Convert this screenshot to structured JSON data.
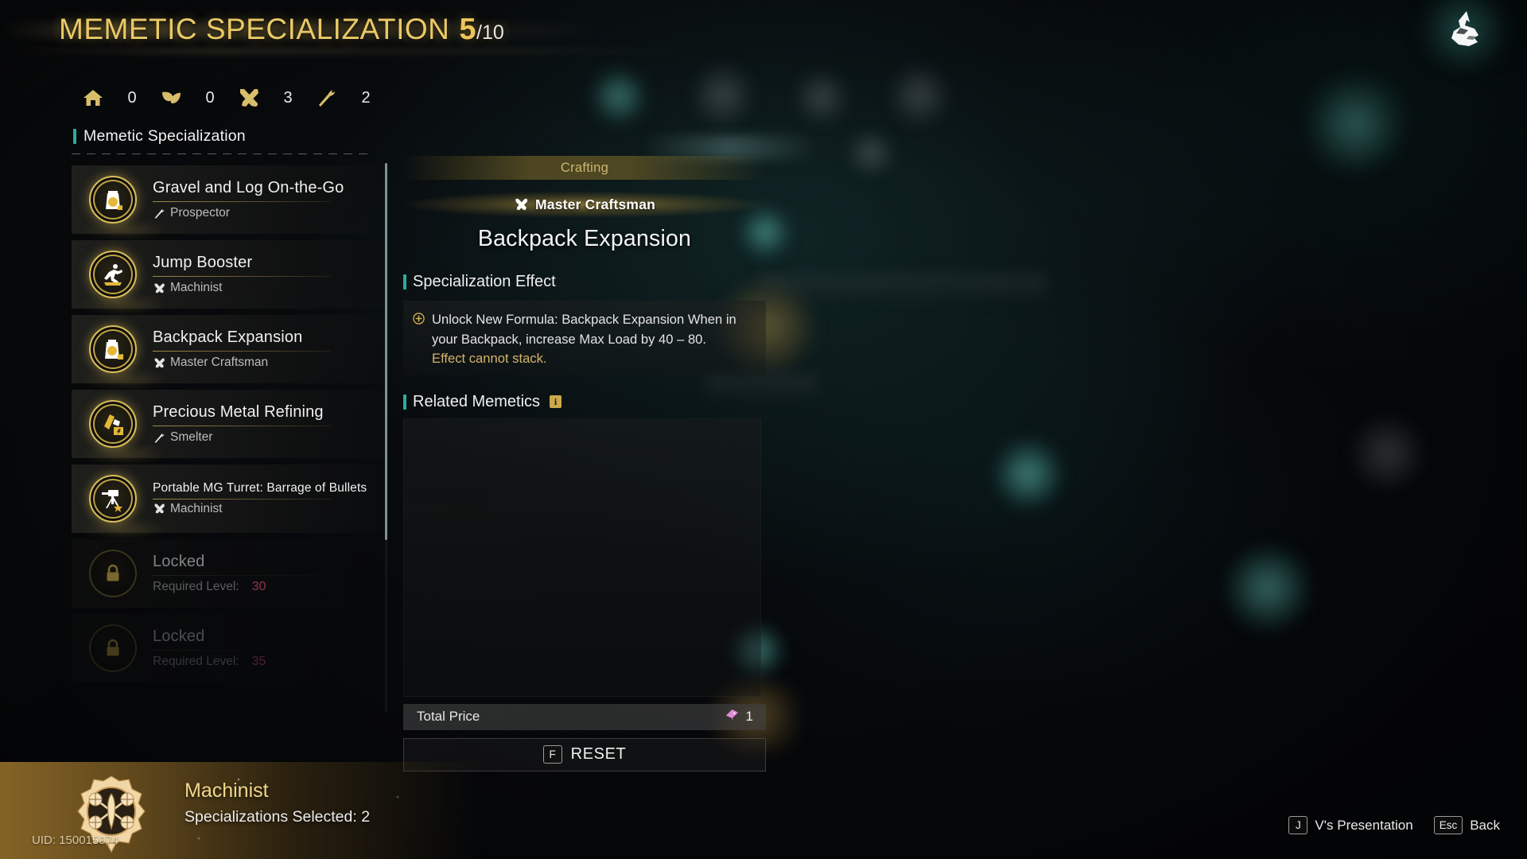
{
  "header": {
    "title": "MEMETIC SPECIALIZATION",
    "current": "5",
    "total": "/10"
  },
  "stats": [
    {
      "icon": "house-icon",
      "value": "0"
    },
    {
      "icon": "leaf-icon",
      "value": "0"
    },
    {
      "icon": "crossed-tools-icon",
      "value": "3"
    },
    {
      "icon": "axe-icon",
      "value": "2"
    }
  ],
  "sidebar": {
    "section_title": "Memetic Specialization",
    "items": [
      {
        "name": "Gravel and Log On-the-Go",
        "class": "Prospector",
        "class_icon": "axe-icon",
        "icon": "bag-gold-icon",
        "state": "unlocked",
        "wrap": false
      },
      {
        "name": "Jump Booster",
        "class": "Machinist",
        "class_icon": "crossed-tools-icon",
        "icon": "jump-runner-icon",
        "state": "unlocked",
        "wrap": false
      },
      {
        "name": "Backpack Expansion",
        "class": "Master Craftsman",
        "class_icon": "crossed-tools-icon",
        "icon": "backpack-icon",
        "state": "unlocked",
        "wrap": false
      },
      {
        "name": "Precious Metal Refining",
        "class": "Smelter",
        "class_icon": "axe-icon",
        "icon": "ingot-icon",
        "state": "unlocked",
        "wrap": false
      },
      {
        "name": "Portable MG Turret: Barrage of Bullets",
        "class": "Machinist",
        "class_icon": "crossed-tools-icon",
        "icon": "turret-icon",
        "state": "unlocked",
        "wrap": true
      },
      {
        "name": "Locked",
        "class_label": "Required Level:",
        "level": "30",
        "icon": "lock-icon",
        "state": "locked"
      },
      {
        "name": "Locked",
        "class_label": "Required Level:",
        "level": "35",
        "icon": "lock-icon",
        "state": "locked"
      }
    ]
  },
  "detail": {
    "category": "Crafting",
    "class_name": "Master Craftsman",
    "class_icon": "crossed-tools-icon",
    "title": "Backpack Expansion",
    "effect_heading": "Specialization Effect",
    "effect_lines": [
      "Unlock New Formula: Backpack Expansion",
      "When in your Backpack, increase Max Load by",
      "40 – 80."
    ],
    "effect_warning": "Effect cannot stack.",
    "related_heading": "Related Memetics",
    "related_info_icon": "info-icon",
    "price_label": "Total Price",
    "price_icon": "currency-icon",
    "price_value": "1",
    "reset_key": "F",
    "reset_label": "RESET"
  },
  "class_card": {
    "name": "Machinist",
    "selected_text": "Specializations Selected: 2",
    "emblem_icon": "machinist-gear-drone-emblem",
    "uid": "UID: 150015074"
  },
  "hints": [
    {
      "key": "J",
      "label": "V's Presentation"
    },
    {
      "key": "Esc",
      "label": "Back"
    }
  ],
  "logo": {
    "icon": "dragon-head-logo"
  },
  "colors": {
    "gold": "#e9c967",
    "teal_accent": "#2fab9c",
    "locked_level": "#e24f78",
    "warning": "#d4b46a",
    "currency": "#e08ad6"
  }
}
